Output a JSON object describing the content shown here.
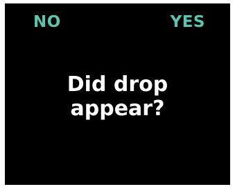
{
  "screen": {
    "background": "#000000",
    "accent_color": "#5fc2ac"
  },
  "softkeys": {
    "left_label": "NO",
    "right_label": "YES"
  },
  "prompt": {
    "line1": "Did drop",
    "line2": "appear?"
  }
}
